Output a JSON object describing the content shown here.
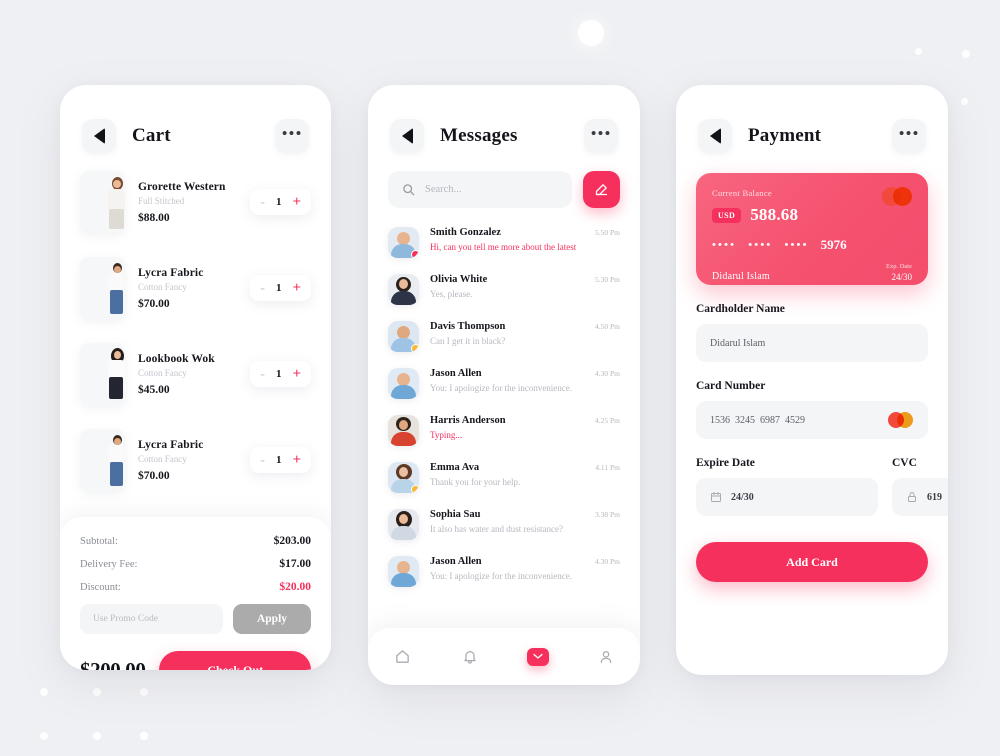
{
  "background": {
    "canvas_color": "#eff0f3",
    "accent_color": "#f5305c",
    "card_pink": "#f5526f"
  },
  "cart": {
    "header": {
      "title": "Cart",
      "back_icon": "back-triangle-icon",
      "menu_icon": "more-dots-icon"
    },
    "items": [
      {
        "name": "Grorette Western",
        "subtitle": "Full Stitched",
        "price": "$88.00",
        "qty": "1",
        "minus": "-",
        "plus": "+",
        "fig": "woman-white-top"
      },
      {
        "name": "Lycra Fabric",
        "subtitle": "Cotton Fancy",
        "price": "$70.00",
        "qty": "1",
        "minus": "-",
        "plus": "+",
        "fig": "man-white-tee"
      },
      {
        "name": "Lookbook Wok",
        "subtitle": "Cotton Fancy",
        "price": "$45.00",
        "qty": "1",
        "minus": "-",
        "plus": "+",
        "fig": "woman-black-pants"
      },
      {
        "name": "Lycra Fabric",
        "subtitle": "Cotton Fancy",
        "price": "$70.00",
        "qty": "1",
        "minus": "-",
        "plus": "+",
        "fig": "man-white-tee"
      }
    ],
    "summary": {
      "rows": [
        {
          "label": "Subtotal:",
          "value": "$203.00",
          "accent": false
        },
        {
          "label": "Delivery Fee:",
          "value": "$17.00",
          "accent": false
        },
        {
          "label": "Discount:",
          "value": "$20.00",
          "accent": true
        }
      ],
      "promo_placeholder": "Use Promo Code",
      "promo_value": "",
      "apply_label": "Apply",
      "grand_total": "$200.00",
      "checkout_label": "Check Out"
    }
  },
  "messages": {
    "header": {
      "title": "Messages",
      "back_icon": "back-triangle-icon",
      "menu_icon": "more-dots-icon"
    },
    "search": {
      "placeholder": "Search...",
      "value": "",
      "icon": "search-icon"
    },
    "compose_icon": "compose-pencil-icon",
    "threads": [
      {
        "name": "Smith Gonzalez",
        "preview": "Hi, can you tell me more about the latest",
        "time": "5.50 Pm",
        "state": "unread",
        "badge": "#f5305c",
        "skin": "#e8b48f",
        "shirt": "#8fb8dd"
      },
      {
        "name": "Olivia White",
        "preview": "Yes, please.",
        "time": "5.30 Pm",
        "state": "read",
        "badge": "",
        "skin": "#e9bb9a",
        "shirt": "#2d3448"
      },
      {
        "name": "Davis Thompson",
        "preview": "Can I get it in black?",
        "time": "4.50 Pm",
        "state": "read",
        "badge": "#f7b731",
        "skin": "#e0a87f",
        "shirt": "#9fc3e4"
      },
      {
        "name": "Jason Allen",
        "preview": "You: I apologize for the inconvenience.",
        "time": "4.30 Pm",
        "state": "read",
        "badge": "",
        "skin": "#e8b48f",
        "shirt": "#6fa8d6"
      },
      {
        "name": "Harris Anderson",
        "preview": "Typing...",
        "time": "4.25 Pm",
        "state": "typing",
        "badge": "",
        "skin": "#e0a87f",
        "shirt": "#d8432f"
      },
      {
        "name": "Emma Ava",
        "preview": "Thank you for your help.",
        "time": "4.11 Pm",
        "state": "read",
        "badge": "#f7b731",
        "skin": "#ecc0a2",
        "shirt": "#b9d3e8"
      },
      {
        "name": "Sophia Sau",
        "preview": "It also has water and dust resistance?",
        "time": "3.38 Pm",
        "state": "read",
        "badge": "",
        "skin": "#e9bb9a",
        "shirt": "#cfd8e3"
      },
      {
        "name": "Jason Allen",
        "preview": "You: I apologize for the inconvenience.",
        "time": "4.30 Pm",
        "state": "read",
        "badge": "",
        "skin": "#e8b48f",
        "shirt": "#6fa8d6"
      }
    ],
    "nav": [
      {
        "icon": "home-icon",
        "active": false
      },
      {
        "icon": "bell-icon",
        "active": false
      },
      {
        "icon": "chat-icon",
        "active": true
      },
      {
        "icon": "person-icon",
        "active": false
      }
    ]
  },
  "payment": {
    "header": {
      "title": "Payment",
      "back_icon": "back-triangle-icon",
      "menu_icon": "more-dots-icon"
    },
    "card": {
      "balance_label": "Current Balance",
      "currency": "USD",
      "amount": "588.68",
      "mask_group": "••••",
      "last_four": "5976",
      "holder": "Didarul Islam",
      "exp_label": "Exp. Date",
      "exp_value": "24/30",
      "brand_icon": "mastercard-icon"
    },
    "fields": {
      "cardholder_label": "Cardholder Name",
      "cardholder_value": "Didarul Islam",
      "cardnumber_label": "Card Number",
      "cardnumber_value": "1536  3245  6987  4529",
      "expire_label": "Expire Date",
      "expire_value": "24/30",
      "expire_icon": "calendar-icon",
      "cvc_label": "CVC",
      "cvc_value": "619",
      "cvc_icon": "lock-icon"
    },
    "add_card_label": "Add Card"
  }
}
